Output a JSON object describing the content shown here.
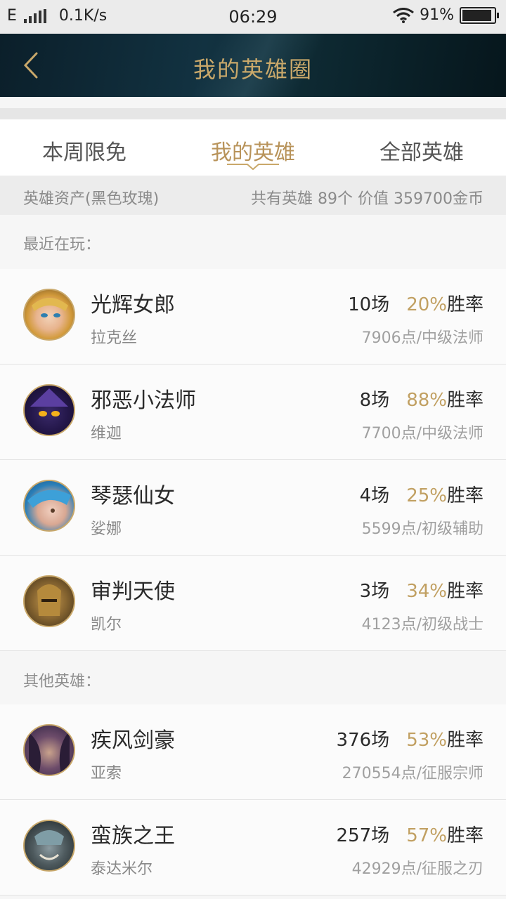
{
  "status": {
    "carrier": "E",
    "speed": "0.1K/s",
    "time": "06:29",
    "battery": "91%"
  },
  "nav": {
    "title": "我的英雄圈"
  },
  "tabs": [
    {
      "label": "本周限免"
    },
    {
      "label": "我的英雄"
    },
    {
      "label": "全部英雄"
    }
  ],
  "assets": {
    "label": "英雄资产(黑色玫瑰)",
    "summary": "共有英雄 89个  价值 359700金币"
  },
  "sections": {
    "recent": "最近在玩：",
    "others": "其他英雄："
  },
  "recent": [
    {
      "name": "光辉女郎",
      "sub": "拉克丝",
      "games": "10场",
      "rate": "20%",
      "rate_suffix": "胜率",
      "level": "7906点/中级法师"
    },
    {
      "name": "邪恶小法师",
      "sub": "维迦",
      "games": "8场",
      "rate": "88%",
      "rate_suffix": "胜率",
      "level": "7700点/中级法师"
    },
    {
      "name": "琴瑟仙女",
      "sub": "娑娜",
      "games": "4场",
      "rate": "25%",
      "rate_suffix": "胜率",
      "level": "5599点/初级辅助"
    },
    {
      "name": "审判天使",
      "sub": "凯尔",
      "games": "3场",
      "rate": "34%",
      "rate_suffix": "胜率",
      "level": "4123点/初级战士"
    }
  ],
  "others": [
    {
      "name": "疾风剑豪",
      "sub": "亚索",
      "games": "376场",
      "rate": "53%",
      "rate_suffix": "胜率",
      "level": "270554点/征服宗师"
    },
    {
      "name": "蛮族之王",
      "sub": "泰达米尔",
      "games": "257场",
      "rate": "57%",
      "rate_suffix": "胜率",
      "level": "42929点/征服之刃"
    }
  ],
  "colors": {
    "accent": "#c1a062",
    "nav_bg": "#0f2b36",
    "tab_active": "#b8935a"
  }
}
